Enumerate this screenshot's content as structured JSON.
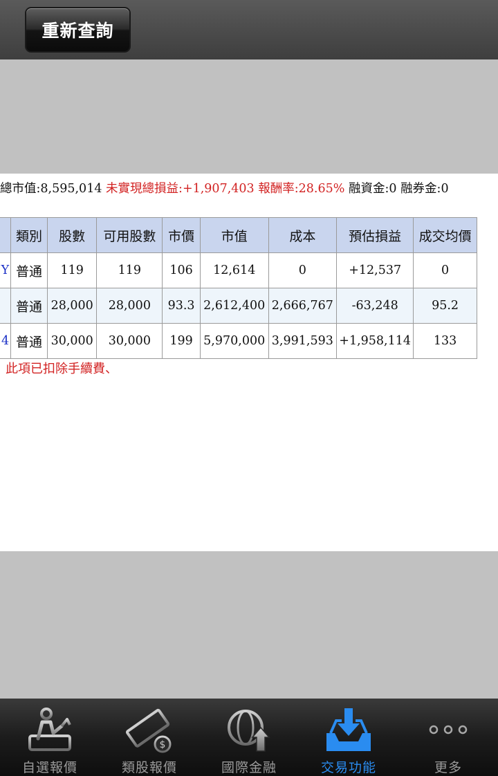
{
  "header": {
    "refresh_label": "重新查詢"
  },
  "summary": {
    "market_value": "總市值:8,595,014",
    "unrealized_pl": "未實現總損益:+1,907,403",
    "return_rate": "報酬率:28.65%",
    "margin_loan": "融資金:0",
    "short_loan": "融券金:0"
  },
  "table": {
    "headers": [
      "類別",
      "股數",
      "可用股數",
      "市價",
      "市值",
      "成本",
      "預估損益",
      "成交均價"
    ],
    "rows": [
      {
        "name": "Y",
        "type": "普通",
        "shares": "119",
        "available": "119",
        "price": "106",
        "value": "12,614",
        "cost": "0",
        "pl": "+12,537",
        "avg": "0"
      },
      {
        "name": "",
        "type": "普通",
        "shares": "28,000",
        "available": "28,000",
        "price": "93.3",
        "value": "2,612,400",
        "cost": "2,666,767",
        "pl": "-63,248",
        "avg": "95.2"
      },
      {
        "name": "4",
        "type": "普通",
        "shares": "30,000",
        "available": "30,000",
        "price": "199",
        "value": "5,970,000",
        "cost": "3,991,593",
        "pl": "+1,958,114",
        "avg": "133"
      }
    ]
  },
  "note": "此項已扣除手續費、",
  "tabs": [
    {
      "label": "自選報價",
      "icon": "person-chart-icon",
      "active": false
    },
    {
      "label": "類股報價",
      "icon": "film-coin-icon",
      "active": false
    },
    {
      "label": "國際金融",
      "icon": "globe-arrow-icon",
      "active": false
    },
    {
      "label": "交易功能",
      "icon": "inbox-download-icon",
      "active": true
    },
    {
      "label": "更多",
      "icon": "more-dots-icon",
      "active": false
    }
  ],
  "colors": {
    "accent": "#2a8cf0",
    "positive": "#d22222",
    "negative": "#1a9a1a",
    "header_bg": "#c9d5ee"
  }
}
